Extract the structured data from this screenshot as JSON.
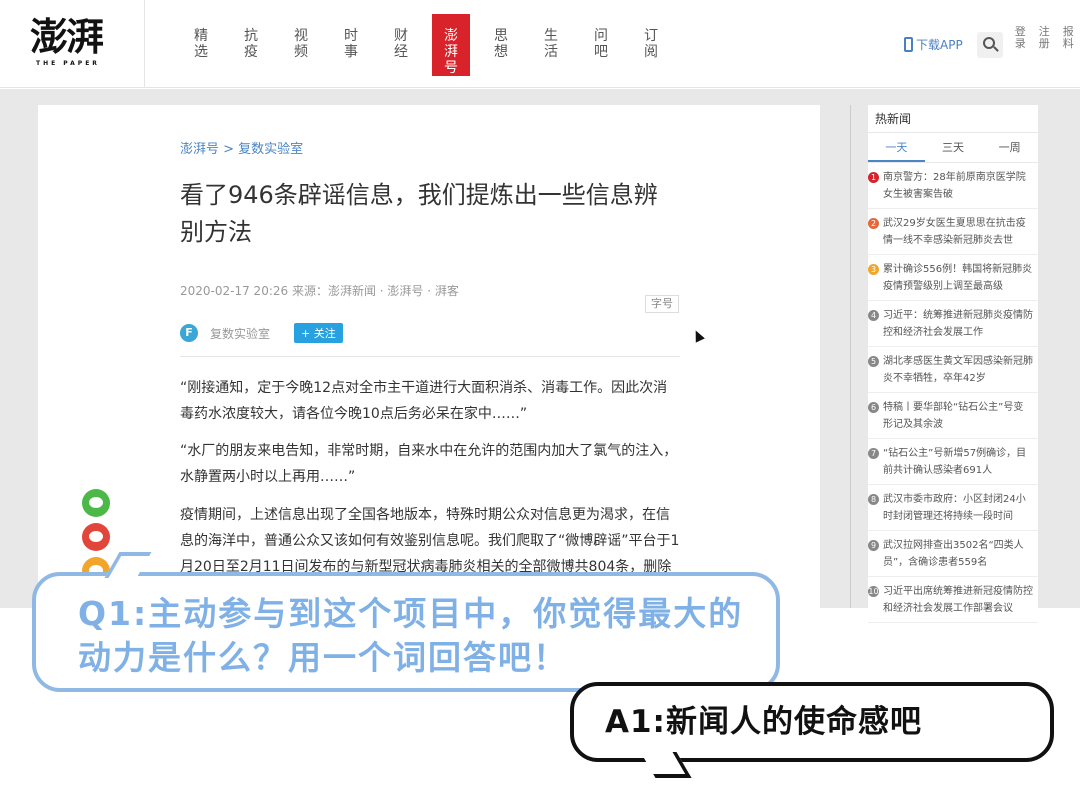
{
  "header": {
    "logo_text": "澎湃",
    "logo_sub": "THE PAPER",
    "nav": [
      {
        "chars": [
          "精",
          "选"
        ]
      },
      {
        "chars": [
          "抗",
          "疫"
        ]
      },
      {
        "chars": [
          "视",
          "频"
        ]
      },
      {
        "chars": [
          "时",
          "事"
        ]
      },
      {
        "chars": [
          "财",
          "经"
        ]
      },
      {
        "chars": [
          "澎",
          "湃",
          "号"
        ],
        "active": true
      },
      {
        "chars": [
          "思",
          "想"
        ]
      },
      {
        "chars": [
          "生",
          "活"
        ]
      },
      {
        "chars": [
          "问",
          "吧"
        ]
      },
      {
        "chars": [
          "订",
          "阅"
        ]
      }
    ],
    "app_download": "下载APP",
    "login": [
      "登",
      "录"
    ],
    "register": [
      "注",
      "册"
    ],
    "report": [
      "报",
      "料"
    ]
  },
  "article": {
    "breadcrumb": "澎湃号 > 复数实验室",
    "title": "看了946条辟谣信息，我们提炼出一些信息辨别方法",
    "meta": "2020-02-17 20:26 来源：澎湃新闻 · 澎湃号 · 湃客",
    "font_button": "字号",
    "author_initial": "F",
    "author_name": "复数实验室",
    "follow_label": "+ 关注",
    "paragraphs": [
      "“刚接通知，定于今晚12点对全市主干道进行大面积消杀、消毒工作。因此次消毒药水浓度较大，请各位今晚10点后务必呆在家中……”",
      "“水厂的朋友来电告知，非常时期，自来水中在允许的范围内加大了氯气的注入，水静置两小时以上再用……”",
      "疫情期间，上述信息出现了全国各地版本，特殊时期公众对信息更为渴求，在信息的海洋中，普通公众又该如何有效鉴别信息呢。我们爬取了“微博辟谣”平台于1月20日至2月11日间发布的与新型冠状病毒肺炎相关的全部微博共804条，删除重"
    ]
  },
  "sidebar": {
    "title": "热新闻",
    "tabs": [
      "一天",
      "三天",
      "一周"
    ],
    "active_tab": 0,
    "items": [
      {
        "num": "1",
        "text": "南京警方：28年前原南京医学院女生被害案告破"
      },
      {
        "num": "2",
        "text": "武汉29岁女医生夏思思在抗击疫情一线不幸感染新冠肺炎去世"
      },
      {
        "num": "3",
        "text": "累计确诊556例！韩国将新冠肺炎疫情预警级别上调至最高级"
      },
      {
        "num": "4",
        "text": "习近平：统筹推进新冠肺炎疫情防控和经济社会发展工作"
      },
      {
        "num": "5",
        "text": "湖北孝感医生黄文军因感染新冠肺炎不幸牺牲，卒年42岁"
      },
      {
        "num": "6",
        "text": "特稿丨要华部轮“钻石公主”号变形记及其余波"
      },
      {
        "num": "7",
        "text": "“钻石公主”号新增57例确诊，目前共计确认感染者691人"
      },
      {
        "num": "8",
        "text": "武汉市委市政府：小区封闭24小时封闭管理还将持续一段时间"
      },
      {
        "num": "9",
        "text": "武汉拉网排查出3502名“四类人员”，含确诊患者559名"
      },
      {
        "num": "10",
        "text": "习近平出席统筹推进新冠疫情防控和经济社会发展工作部署会议"
      }
    ]
  },
  "overlay": {
    "question": "Q1:主动参与到这个项目中，你觉得最大的动力是什么？用一个词回答吧！",
    "answer": "A1:新闻人的使命感吧"
  },
  "colors": {
    "brand_red": "#d8232a",
    "link_blue": "#4a86c5",
    "question_blue": "#7fb0e6"
  }
}
